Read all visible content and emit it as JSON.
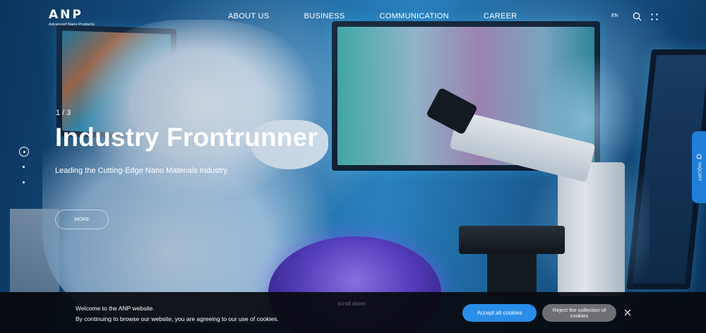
{
  "header": {
    "logo_mark": "ANP",
    "logo_sub": "Advanced Nano Products",
    "nav": [
      "ABOUT US",
      "BUSINESS",
      "COMMUNICATION",
      "CAREER"
    ],
    "lang": "EN",
    "search_icon": "search-icon",
    "menu_icon": "grid-menu-icon"
  },
  "hero": {
    "counter": "1 / 3",
    "title": "Industry Frontrunner",
    "subtitle": "Leading the Cutting-Edge Nano Materials Industry",
    "more_label": "MORE",
    "scroll_label": "scroll down",
    "slides_total": 3,
    "active_slide": 1
  },
  "side_tab": {
    "label": "INQUIRY",
    "icon": "inquiry-icon",
    "color": "#1f7fd8"
  },
  "cookie": {
    "line1": "Welcome to the ANP website.",
    "line2": "By continuing to browse our website, you are agreeing to our use of cookies.",
    "accept_label": "Accept all cookies",
    "reject_label": "Reject the collection of cookies",
    "close_icon": "close-icon",
    "accept_color": "#2a8ee8",
    "reject_color": "#6d6f73"
  }
}
